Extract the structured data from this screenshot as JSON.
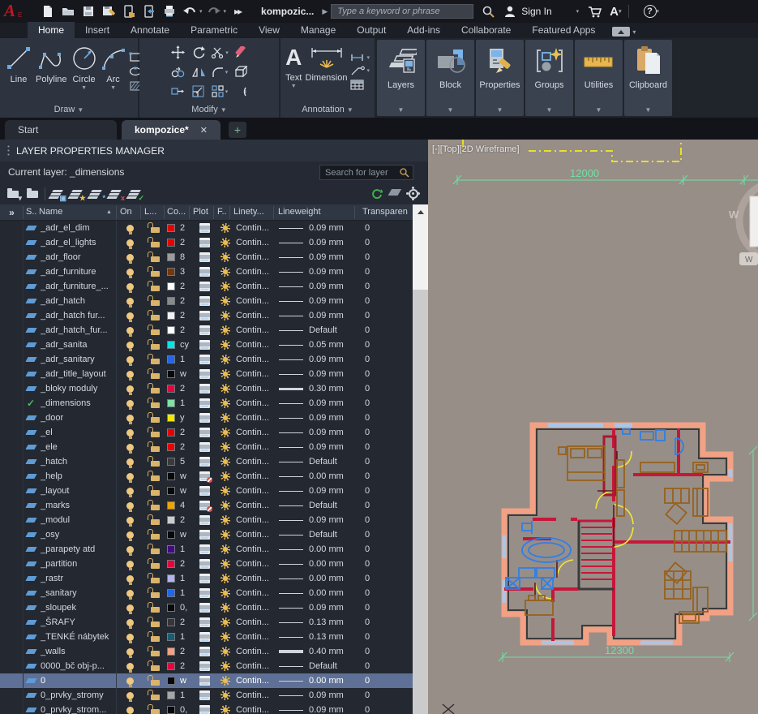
{
  "titlebar": {
    "doc_title": "kompozic...",
    "search_placeholder": "Type a keyword or phrase",
    "signin_label": "Sign In"
  },
  "ribbon": {
    "tabs": [
      "Home",
      "Insert",
      "Annotate",
      "Parametric",
      "View",
      "Manage",
      "Output",
      "Add-ins",
      "Collaborate",
      "Featured Apps"
    ],
    "active_tab": "Home",
    "panels": {
      "draw": "Draw",
      "modify": "Modify",
      "annotation": "Annotation"
    },
    "buttons": {
      "line": "Line",
      "polyline": "Polyline",
      "circle": "Circle",
      "arc": "Arc",
      "text": "Text",
      "dimension": "Dimension"
    },
    "tiles": [
      "Layers",
      "Block",
      "Properties",
      "Groups",
      "Utilities",
      "Clipboard"
    ]
  },
  "filetabs": {
    "start": "Start",
    "doc": "kompozice*",
    "new_tab": "+"
  },
  "lpm": {
    "title": "LAYER PROPERTIES MANAGER",
    "current_layer": "Current layer: _dimensions",
    "search_placeholder": "Search for layer",
    "headers": [
      "»",
      "S..",
      "Name",
      "On",
      "L...",
      "Co...",
      "Plot",
      "F..",
      "Linety...",
      "Lineweight",
      "Transparen"
    ],
    "linetype": "Contin...",
    "transparency": "0",
    "rows": [
      {
        "name": "_adr_el_dim",
        "color": "#e80000",
        "c": "2",
        "lw": "0.09 mm",
        "plot": true,
        "cur": false,
        "sel": false
      },
      {
        "name": "_adr_el_lights",
        "color": "#e80000",
        "c": "2",
        "lw": "0.09 mm",
        "plot": true,
        "cur": false,
        "sel": false
      },
      {
        "name": "_adr_floor",
        "color": "#9c9c9c",
        "c": "8",
        "lw": "0.09 mm",
        "plot": true,
        "cur": false,
        "sel": false
      },
      {
        "name": "_adr_furniture",
        "color": "#76380c",
        "c": "3",
        "lw": "0.09 mm",
        "plot": true,
        "cur": false,
        "sel": false
      },
      {
        "name": "_adr_furniture_...",
        "color": "#ffffff",
        "c": "2",
        "lw": "0.09 mm",
        "plot": true,
        "cur": false,
        "sel": false
      },
      {
        "name": "_adr_hatch",
        "color": "#8a8a8a",
        "c": "2",
        "lw": "0.09 mm",
        "plot": true,
        "cur": false,
        "sel": false
      },
      {
        "name": "_adr_hatch fur...",
        "color": "#f2f2f2",
        "c": "2",
        "lw": "0.09 mm",
        "plot": true,
        "cur": false,
        "sel": false
      },
      {
        "name": "_adr_hatch_fur...",
        "color": "#ffffff",
        "c": "2",
        "lw": "Default",
        "plot": true,
        "cur": false,
        "sel": false
      },
      {
        "name": "_adr_sanita",
        "color": "#00e6e6",
        "c": "cy",
        "lw": "0.05 mm",
        "plot": true,
        "cur": false,
        "sel": false
      },
      {
        "name": "_adr_sanitary",
        "color": "#2066ee",
        "c": "1",
        "lw": "0.09 mm",
        "plot": true,
        "cur": false,
        "sel": false
      },
      {
        "name": "_adr_title_layout",
        "color": "#080808",
        "c": "w",
        "lw": "0.09 mm",
        "plot": true,
        "cur": false,
        "sel": false
      },
      {
        "name": "_bloky moduly",
        "color": "#e6043c",
        "c": "2",
        "lw": "0.30 mm",
        "plot": true,
        "cur": false,
        "sel": false
      },
      {
        "name": "_dimensions",
        "color": "#7de2a2",
        "c": "1",
        "lw": "0.09 mm",
        "plot": true,
        "cur": true,
        "sel": false
      },
      {
        "name": "_door",
        "color": "#f0e800",
        "c": "y",
        "lw": "0.09 mm",
        "plot": true,
        "cur": false,
        "sel": false
      },
      {
        "name": "_el",
        "color": "#e80000",
        "c": "2",
        "lw": "0.09 mm",
        "plot": true,
        "cur": false,
        "sel": false
      },
      {
        "name": "_ele",
        "color": "#e80000",
        "c": "2",
        "lw": "0.09 mm",
        "plot": true,
        "cur": false,
        "sel": false
      },
      {
        "name": "_hatch",
        "color": "#3a3a3a",
        "c": "5",
        "lw": "Default",
        "plot": true,
        "cur": false,
        "sel": false
      },
      {
        "name": "_help",
        "color": "#080808",
        "c": "w",
        "lw": "0.00 mm",
        "plot": false,
        "cur": false,
        "sel": false
      },
      {
        "name": "_layout",
        "color": "#080808",
        "c": "w",
        "lw": "0.09 mm",
        "plot": true,
        "cur": false,
        "sel": false
      },
      {
        "name": "_marks",
        "color": "#f0a400",
        "c": "4",
        "lw": "Default",
        "plot": false,
        "cur": false,
        "sel": false
      },
      {
        "name": "_modul",
        "color": "#cdcdcd",
        "c": "2",
        "lw": "0.09 mm",
        "plot": true,
        "cur": false,
        "sel": false
      },
      {
        "name": "_osy",
        "color": "#080808",
        "c": "w",
        "lw": "Default",
        "plot": true,
        "cur": false,
        "sel": false
      },
      {
        "name": "_parapety atd",
        "color": "#440a85",
        "c": "1",
        "lw": "0.00 mm",
        "plot": true,
        "cur": false,
        "sel": false
      },
      {
        "name": "_partition",
        "color": "#e6043c",
        "c": "2",
        "lw": "0.00 mm",
        "plot": true,
        "cur": false,
        "sel": false
      },
      {
        "name": "_rastr",
        "color": "#b6b2ef",
        "c": "1",
        "lw": "0.00 mm",
        "plot": true,
        "cur": false,
        "sel": false
      },
      {
        "name": "_sanitary",
        "color": "#2066ee",
        "c": "1",
        "lw": "0.00 mm",
        "plot": true,
        "cur": false,
        "sel": false
      },
      {
        "name": "_sloupek",
        "color": "#080808",
        "c": "0,",
        "lw": "0.09 mm",
        "plot": true,
        "cur": false,
        "sel": false
      },
      {
        "name": "_ŠRAFY",
        "color": "#363636",
        "c": "2",
        "lw": "0.13 mm",
        "plot": true,
        "cur": false,
        "sel": false
      },
      {
        "name": "_TENKÉ nábytek",
        "color": "#185e72",
        "c": "1",
        "lw": "0.13 mm",
        "plot": true,
        "cur": false,
        "sel": false
      },
      {
        "name": "_walls",
        "color": "#f2a284",
        "c": "2",
        "lw": "0.40 mm",
        "plot": true,
        "cur": false,
        "sel": false
      },
      {
        "name": "0000_bč obj-p...",
        "color": "#e6043c",
        "c": "2",
        "lw": "Default",
        "plot": true,
        "cur": false,
        "sel": false
      },
      {
        "name": "0",
        "color": "#080808",
        "c": "w",
        "lw": "0.00 mm",
        "plot": true,
        "cur": false,
        "sel": true
      },
      {
        "name": "0_prvky_stromy",
        "color": "#a6a6a6",
        "c": "1",
        "lw": "0.09 mm",
        "plot": true,
        "cur": false,
        "sel": false
      },
      {
        "name": "0_prvky_strom...",
        "color": "#080808",
        "c": "0,",
        "lw": "0.09 mm",
        "plot": true,
        "cur": false,
        "sel": false
      }
    ]
  },
  "viewport": {
    "label": "[-][Top][2D Wireframe]",
    "dim_top": "12000",
    "dim_bottom": "12300",
    "viewcube_label": "W",
    "wcs_badge": "W"
  },
  "colors": {
    "selection": "#5e7095",
    "canvas_background": "#978e88",
    "dimension_green": "#72dfa2",
    "wall_salmon": "#f2a184",
    "partition_crimson": "#c6173a",
    "door_yellow": "#eee73b",
    "fixture_blue": "#2f7fe8",
    "furniture_brown": "#96621e"
  }
}
